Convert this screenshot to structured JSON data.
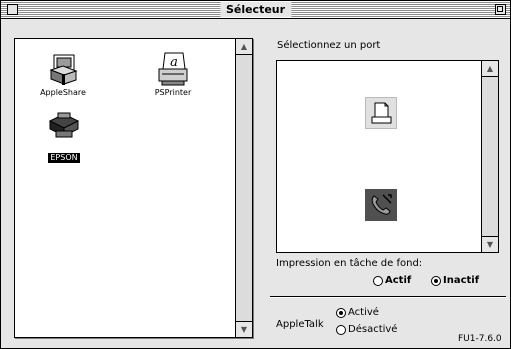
{
  "window": {
    "title": "Sélecteur"
  },
  "drivers": [
    {
      "label": "AppleShare",
      "icon": "appleshare-icon",
      "selected": false
    },
    {
      "label": "PSPrinter",
      "icon": "psprinter-icon",
      "selected": false
    },
    {
      "label": "EPSON",
      "icon": "epson-printer-icon",
      "selected": true
    }
  ],
  "port": {
    "label": "Sélectionnez un port",
    "items": [
      {
        "icon": "printer-port-icon",
        "selected": false
      },
      {
        "icon": "modem-port-icon",
        "selected": true
      }
    ]
  },
  "background_printing": {
    "label": "Impression en tâche de fond:",
    "options": [
      {
        "label": "Actif",
        "selected": false
      },
      {
        "label": "Inactif",
        "selected": true
      }
    ]
  },
  "appletalk": {
    "label": "AppleTalk",
    "options": [
      {
        "label": "Activé",
        "selected": true
      },
      {
        "label": "Désactivé",
        "selected": false
      }
    ]
  },
  "version": "FU1-7.6.0"
}
